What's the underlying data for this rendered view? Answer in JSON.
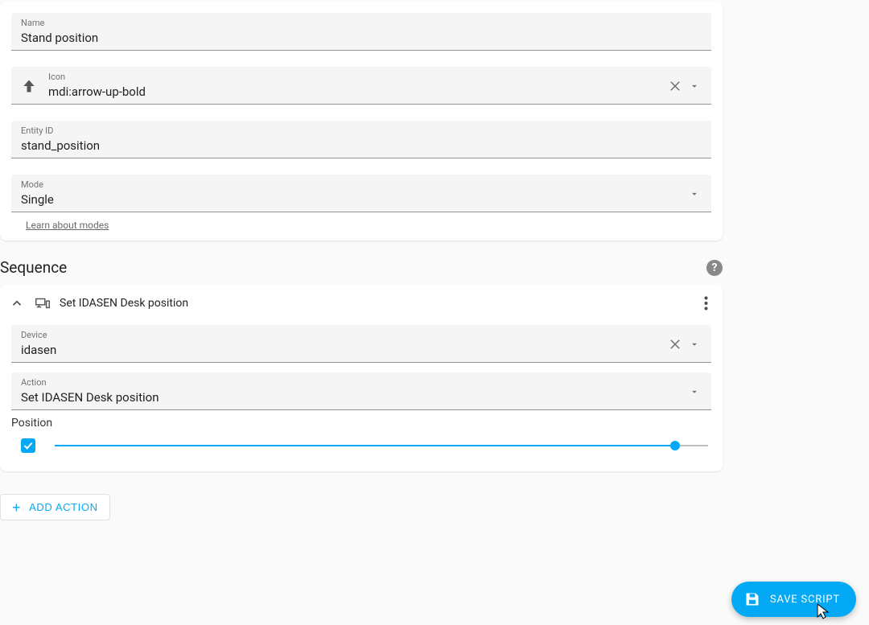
{
  "fields": {
    "name": {
      "label": "Name",
      "value": "Stand position"
    },
    "icon": {
      "label": "Icon",
      "value": "mdi:arrow-up-bold"
    },
    "entity_id": {
      "label": "Entity ID",
      "value": "stand_position"
    },
    "mode": {
      "label": "Mode",
      "value": "Single"
    }
  },
  "learn_modes_text": "Learn about modes",
  "sequence": {
    "heading": "Sequence",
    "action_title": "Set IDASEN Desk position",
    "device": {
      "label": "Device",
      "value": "idasen"
    },
    "action": {
      "label": "Action",
      "value": "Set IDASEN Desk position"
    },
    "position": {
      "label": "Position",
      "enabled": true,
      "value_percent": 95
    }
  },
  "add_action_label": "ADD ACTION",
  "save_label": "SAVE SCRIPT"
}
